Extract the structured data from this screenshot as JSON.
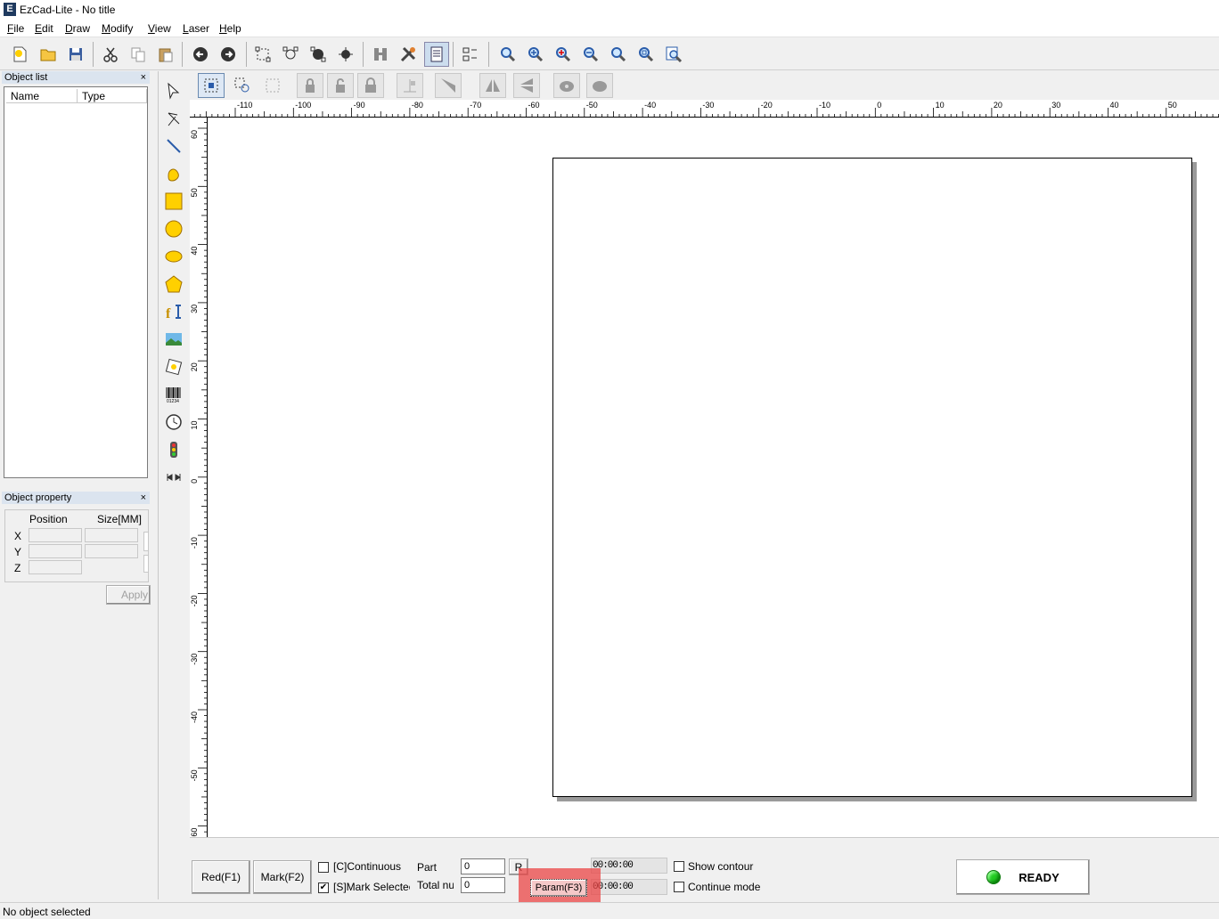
{
  "window": {
    "title": "EzCad-Lite  - No title",
    "app_icon": "ezcad-app-icon"
  },
  "menu": [
    {
      "label": "File",
      "accel": "F"
    },
    {
      "label": "Edit",
      "accel": "E"
    },
    {
      "label": "Draw",
      "accel": "D"
    },
    {
      "label": "Modify",
      "accel": "M"
    },
    {
      "label": "View",
      "accel": "V"
    },
    {
      "label": "Laser",
      "accel": "L"
    },
    {
      "label": "Help",
      "accel": "H"
    }
  ],
  "object_list": {
    "title": "Object list",
    "close": "×",
    "columns": [
      "Name",
      "Type"
    ],
    "rows": []
  },
  "object_property": {
    "title": "Object property",
    "close": "×",
    "position_label": "Position",
    "size_label": "Size[MM]",
    "axes": [
      "X",
      "Y",
      "Z"
    ],
    "apply_label": "Apply"
  },
  "rulers": {
    "horizontal_labels": [
      "-110",
      "-100",
      "-90",
      "-80",
      "-70",
      "-60",
      "-50",
      "-40",
      "-30",
      "-20",
      "-10",
      "0",
      "10",
      "20",
      "30",
      "40",
      "50"
    ],
    "vertical_labels": [
      "60",
      "50",
      "40",
      "30",
      "20",
      "10",
      "0",
      "-10",
      "-20",
      "-30",
      "-40",
      "-50",
      "-60"
    ]
  },
  "bottom": {
    "red_button": "Red(F1)",
    "mark_button": "Mark(F2)",
    "continuous_label": "[C]Continuous",
    "continuous_checked": false,
    "mark_selected_label": "[S]Mark Selectec",
    "mark_selected_checked": true,
    "part_label": "Part",
    "part_value": "0",
    "total_label": "Total nu",
    "total_value": "0",
    "reset_button": "R",
    "param_button": "Param(F3)",
    "time1": "00:00:00",
    "time2": "00:00:00",
    "show_contour_label": "Show contour",
    "show_contour_checked": false,
    "continue_mode_label": "Continue mode",
    "continue_mode_checked": false,
    "status_text": "READY",
    "status_color": "#22cc22"
  },
  "statusbar": {
    "text": "No object selected"
  },
  "highlight_color": "#eb4646"
}
